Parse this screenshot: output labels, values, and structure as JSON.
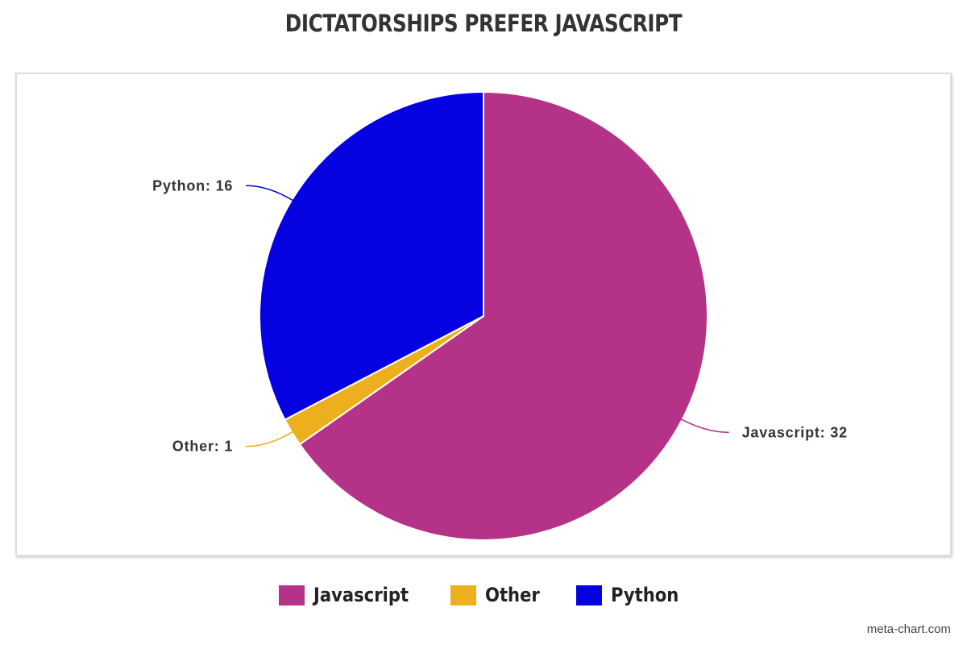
{
  "chart_data": {
    "type": "pie",
    "title": "DICTATORSHIPS PREFER JAVASCRIPT",
    "slices": [
      {
        "label": "Javascript",
        "value": 32,
        "color": "#b43287"
      },
      {
        "label": "Other",
        "value": 1,
        "color": "#ecb01e"
      },
      {
        "label": "Python",
        "value": 16,
        "color": "#0501e0"
      }
    ],
    "slice_labels": [
      "Javascript: 32",
      "Other: 1",
      "Python: 16"
    ],
    "legend": {
      "placement": "bottom",
      "entries": [
        "Javascript",
        "Other",
        "Python"
      ]
    }
  },
  "watermark": "meta-chart.com"
}
